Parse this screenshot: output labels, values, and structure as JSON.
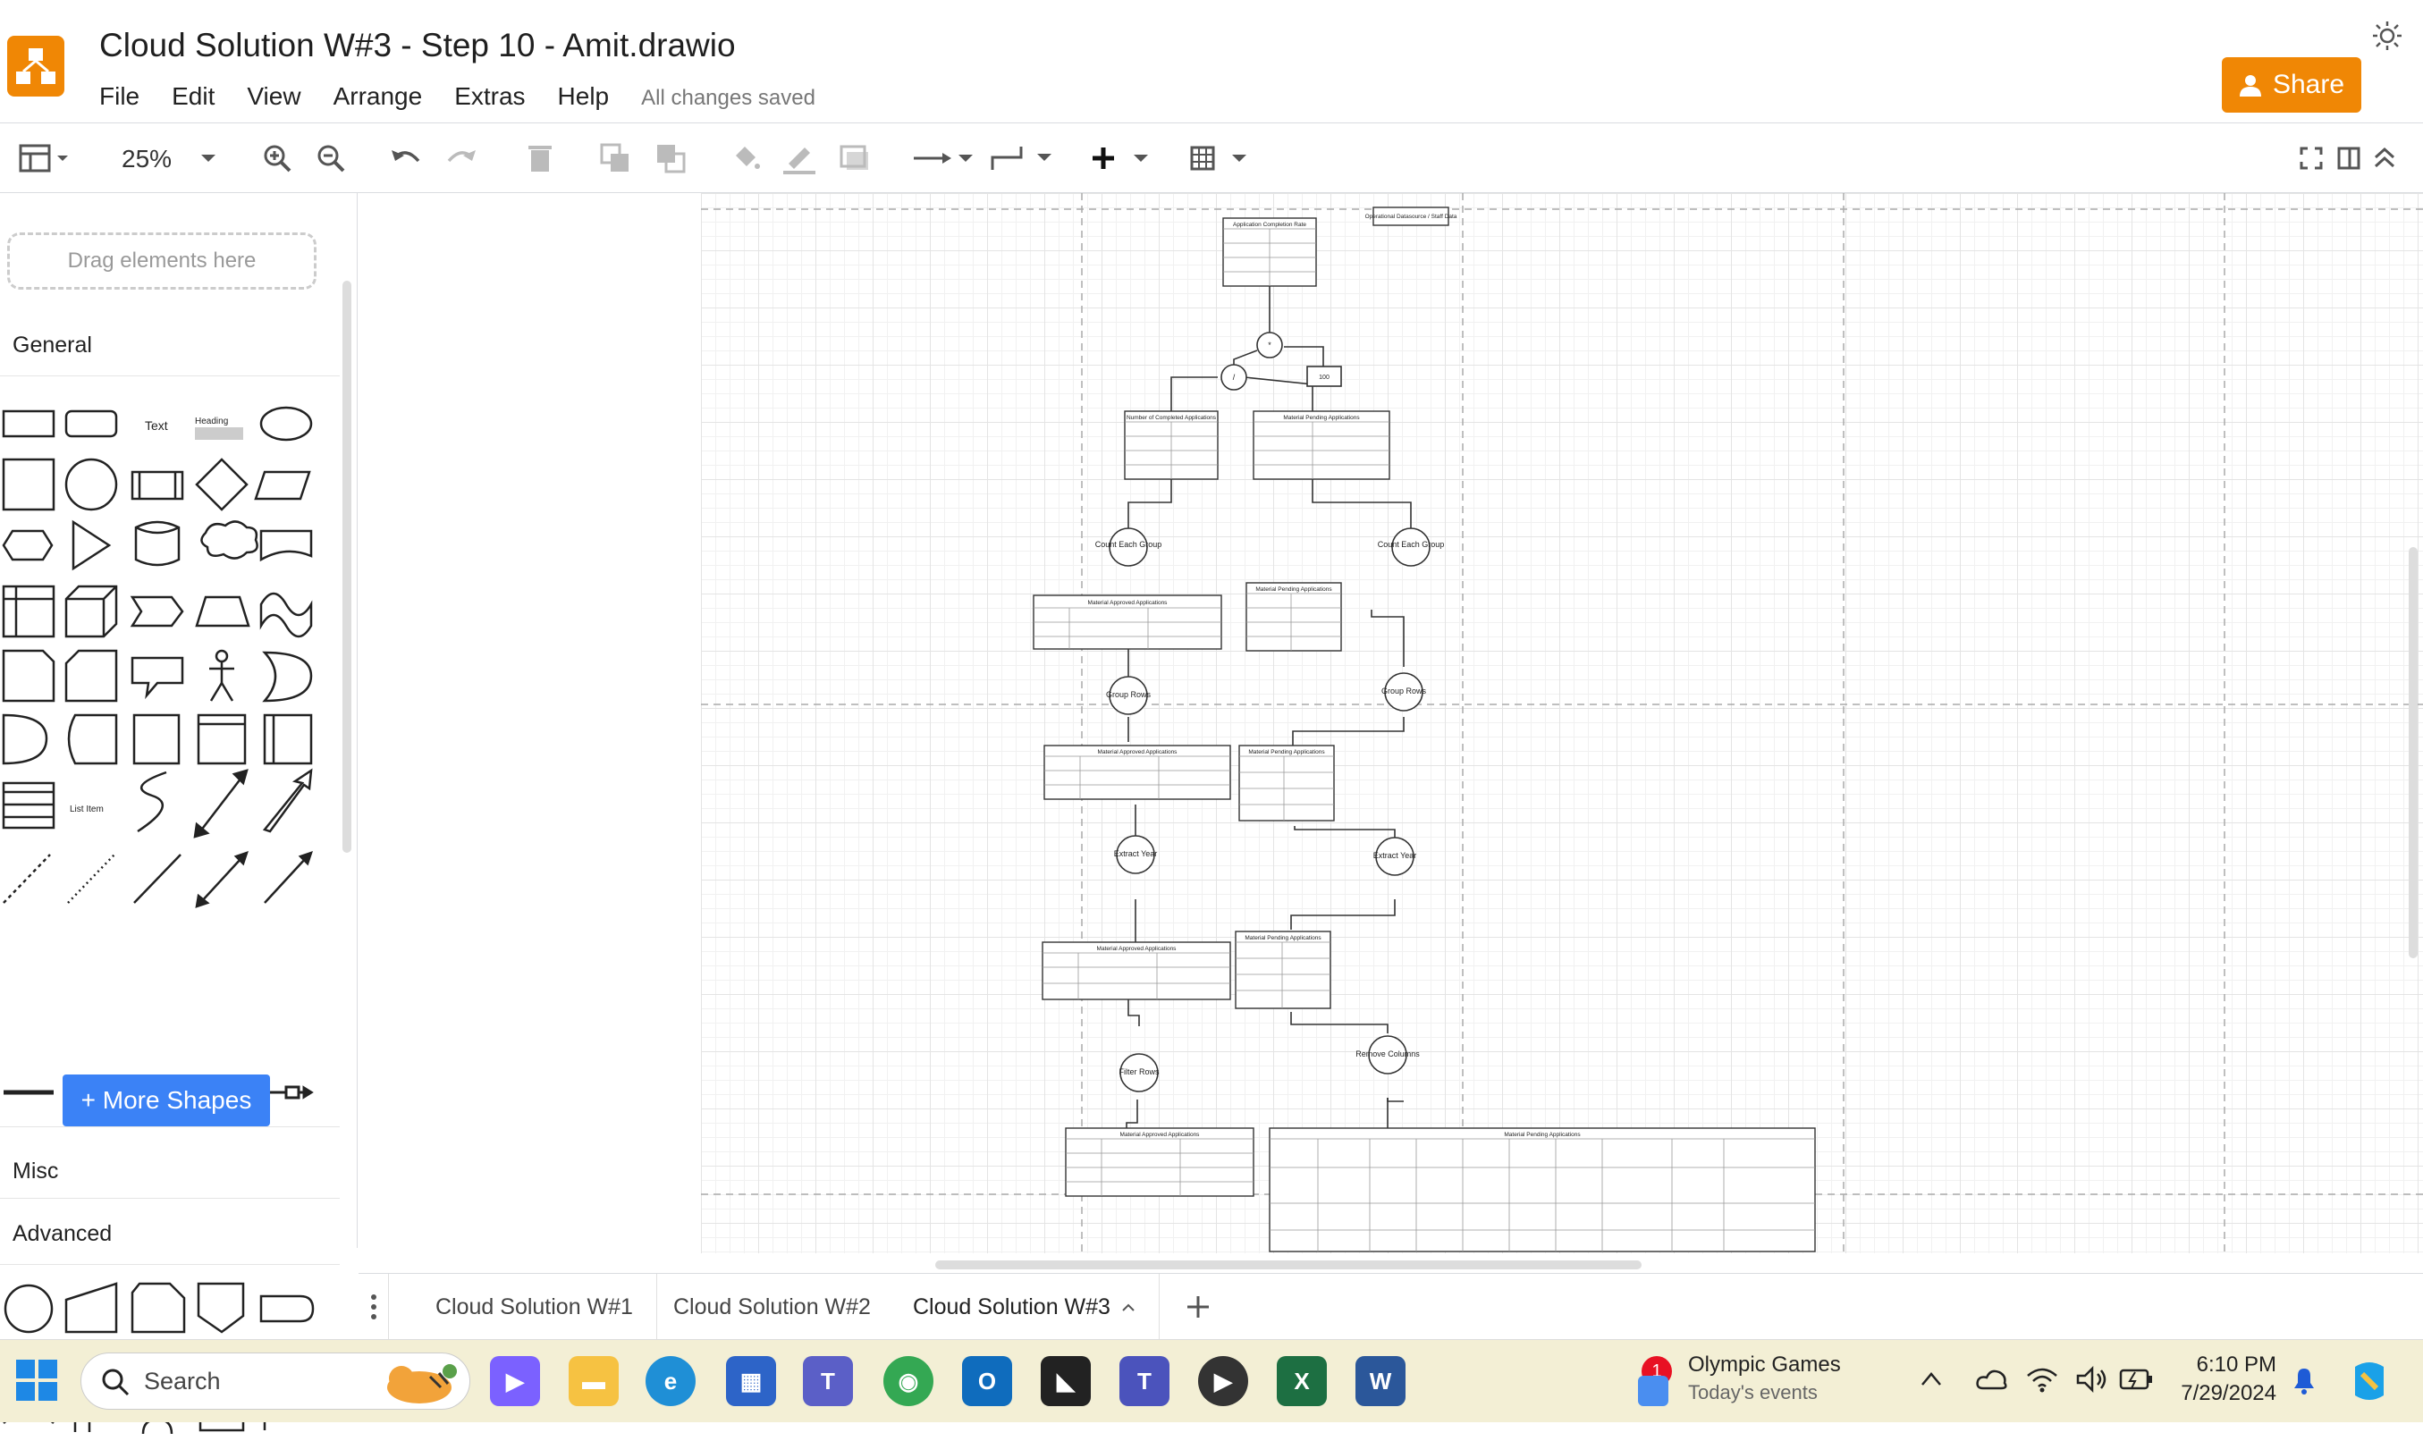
{
  "app": {
    "title": "Cloud Solution W#3 - Step 10 - Amit.drawio",
    "saved_status": "All changes saved",
    "share_label": "Share",
    "menu": [
      "File",
      "Edit",
      "View",
      "Arrange",
      "Extras",
      "Help"
    ],
    "accent_color": "#f08705"
  },
  "toolbar": {
    "zoom": "25%"
  },
  "sidebar": {
    "drop_hint": "Drag elements here",
    "sections": {
      "general": "General",
      "misc": "Misc",
      "advanced": "Advanced"
    },
    "shape_labels": {
      "text": "Text",
      "heading": "Heading",
      "list_item": "List Item"
    },
    "more_shapes": "+ More Shapes"
  },
  "diagram": {
    "tables": {
      "completion_rate": "Application Completion Rate",
      "completed": "Number of Completed Applications",
      "pending_count": "Material Pending Applications",
      "approved_grouped": "Material Approved Applications",
      "pending_grouped": "Material Pending Applications",
      "approved_year": "Material Approved Applications",
      "pending_year": "Material Pending Applications",
      "approved_cols": "Material Approved Applications",
      "pending_cols": "Material Pending Applications",
      "approved_filtered": "Material Approved Applications",
      "pending_full": "Material Pending Applications",
      "operational": "Operational Datasource / Staff Data"
    },
    "operators": {
      "multiply": "*",
      "divide": "/",
      "hundred": "100"
    },
    "steps": {
      "count_left": "Count Each Group",
      "count_right": "Count Each Group",
      "group_left": "Group Rows",
      "group_right": "Group Rows",
      "extract_left": "Extract Year",
      "extract_right": "Extract Year",
      "filter": "Filter Rows",
      "remove": "Remove Columns"
    }
  },
  "tabs": [
    "Cloud Solution W#1",
    "Cloud Solution W#2",
    "Cloud Solution W#3"
  ],
  "taskbar": {
    "search": "Search",
    "notification_title": "Olympic Games",
    "notification_sub": "Today's events",
    "notification_badge": "1",
    "time": "6:10 PM",
    "date": "7/29/2024"
  }
}
